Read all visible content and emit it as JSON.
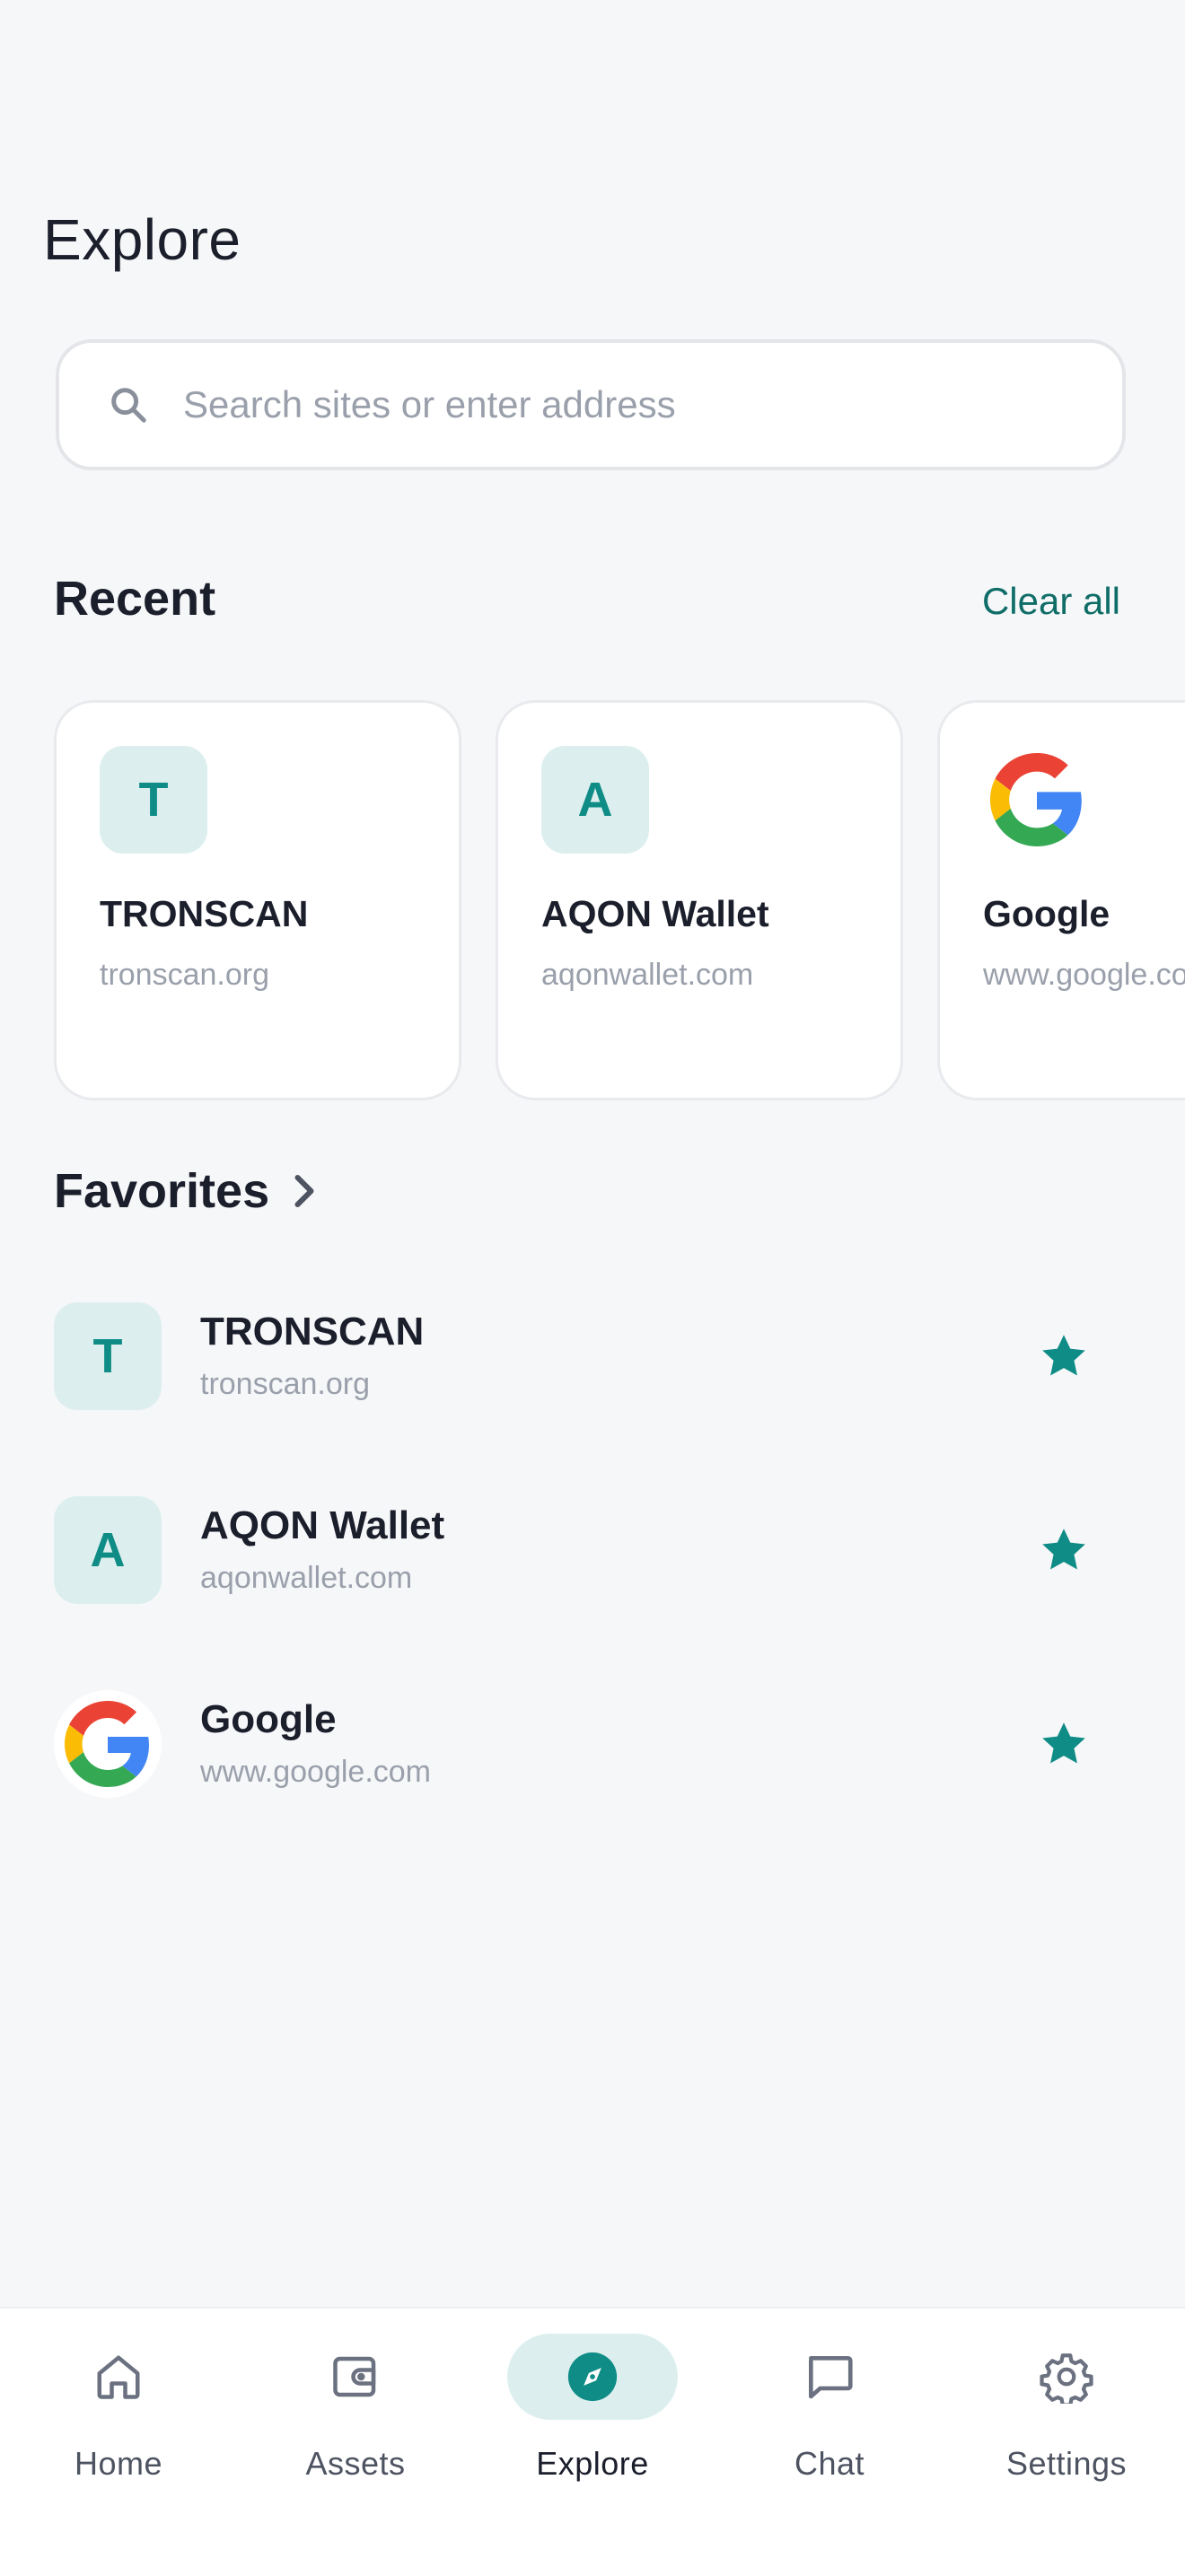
{
  "header": {
    "title": "Explore"
  },
  "search": {
    "placeholder": "Search sites or enter address"
  },
  "recent": {
    "title": "Recent",
    "clear_label": "Clear all",
    "items": [
      {
        "initial": "T",
        "name": "TRONSCAN",
        "url": "tronscan.org",
        "icon": "letter-badge"
      },
      {
        "initial": "A",
        "name": "AQON Wallet",
        "url": "aqonwallet.com",
        "icon": "letter-badge"
      },
      {
        "name": "Google",
        "url": "www.google.com",
        "icon": "google-logo"
      }
    ]
  },
  "favorites": {
    "title": "Favorites",
    "items": [
      {
        "initial": "T",
        "name": "TRONSCAN",
        "url": "tronscan.org",
        "starred": true
      },
      {
        "initial": "A",
        "name": "AQON Wallet",
        "url": "aqonwallet.com",
        "starred": true
      },
      {
        "name": "Google",
        "url": "www.google.com",
        "starred": true,
        "icon": "google-logo"
      }
    ]
  },
  "tabbar": {
    "active": "Explore",
    "items": [
      {
        "label": "Home",
        "icon": "home-icon"
      },
      {
        "label": "Assets",
        "icon": "wallet-icon"
      },
      {
        "label": "Explore",
        "icon": "compass-icon"
      },
      {
        "label": "Chat",
        "icon": "chat-icon"
      },
      {
        "label": "Settings",
        "icon": "gear-icon"
      }
    ]
  },
  "colors": {
    "accent": "#0f8c86",
    "accent_soft": "#dcefee",
    "link": "#0f6d68",
    "background": "#f6f7f9"
  }
}
